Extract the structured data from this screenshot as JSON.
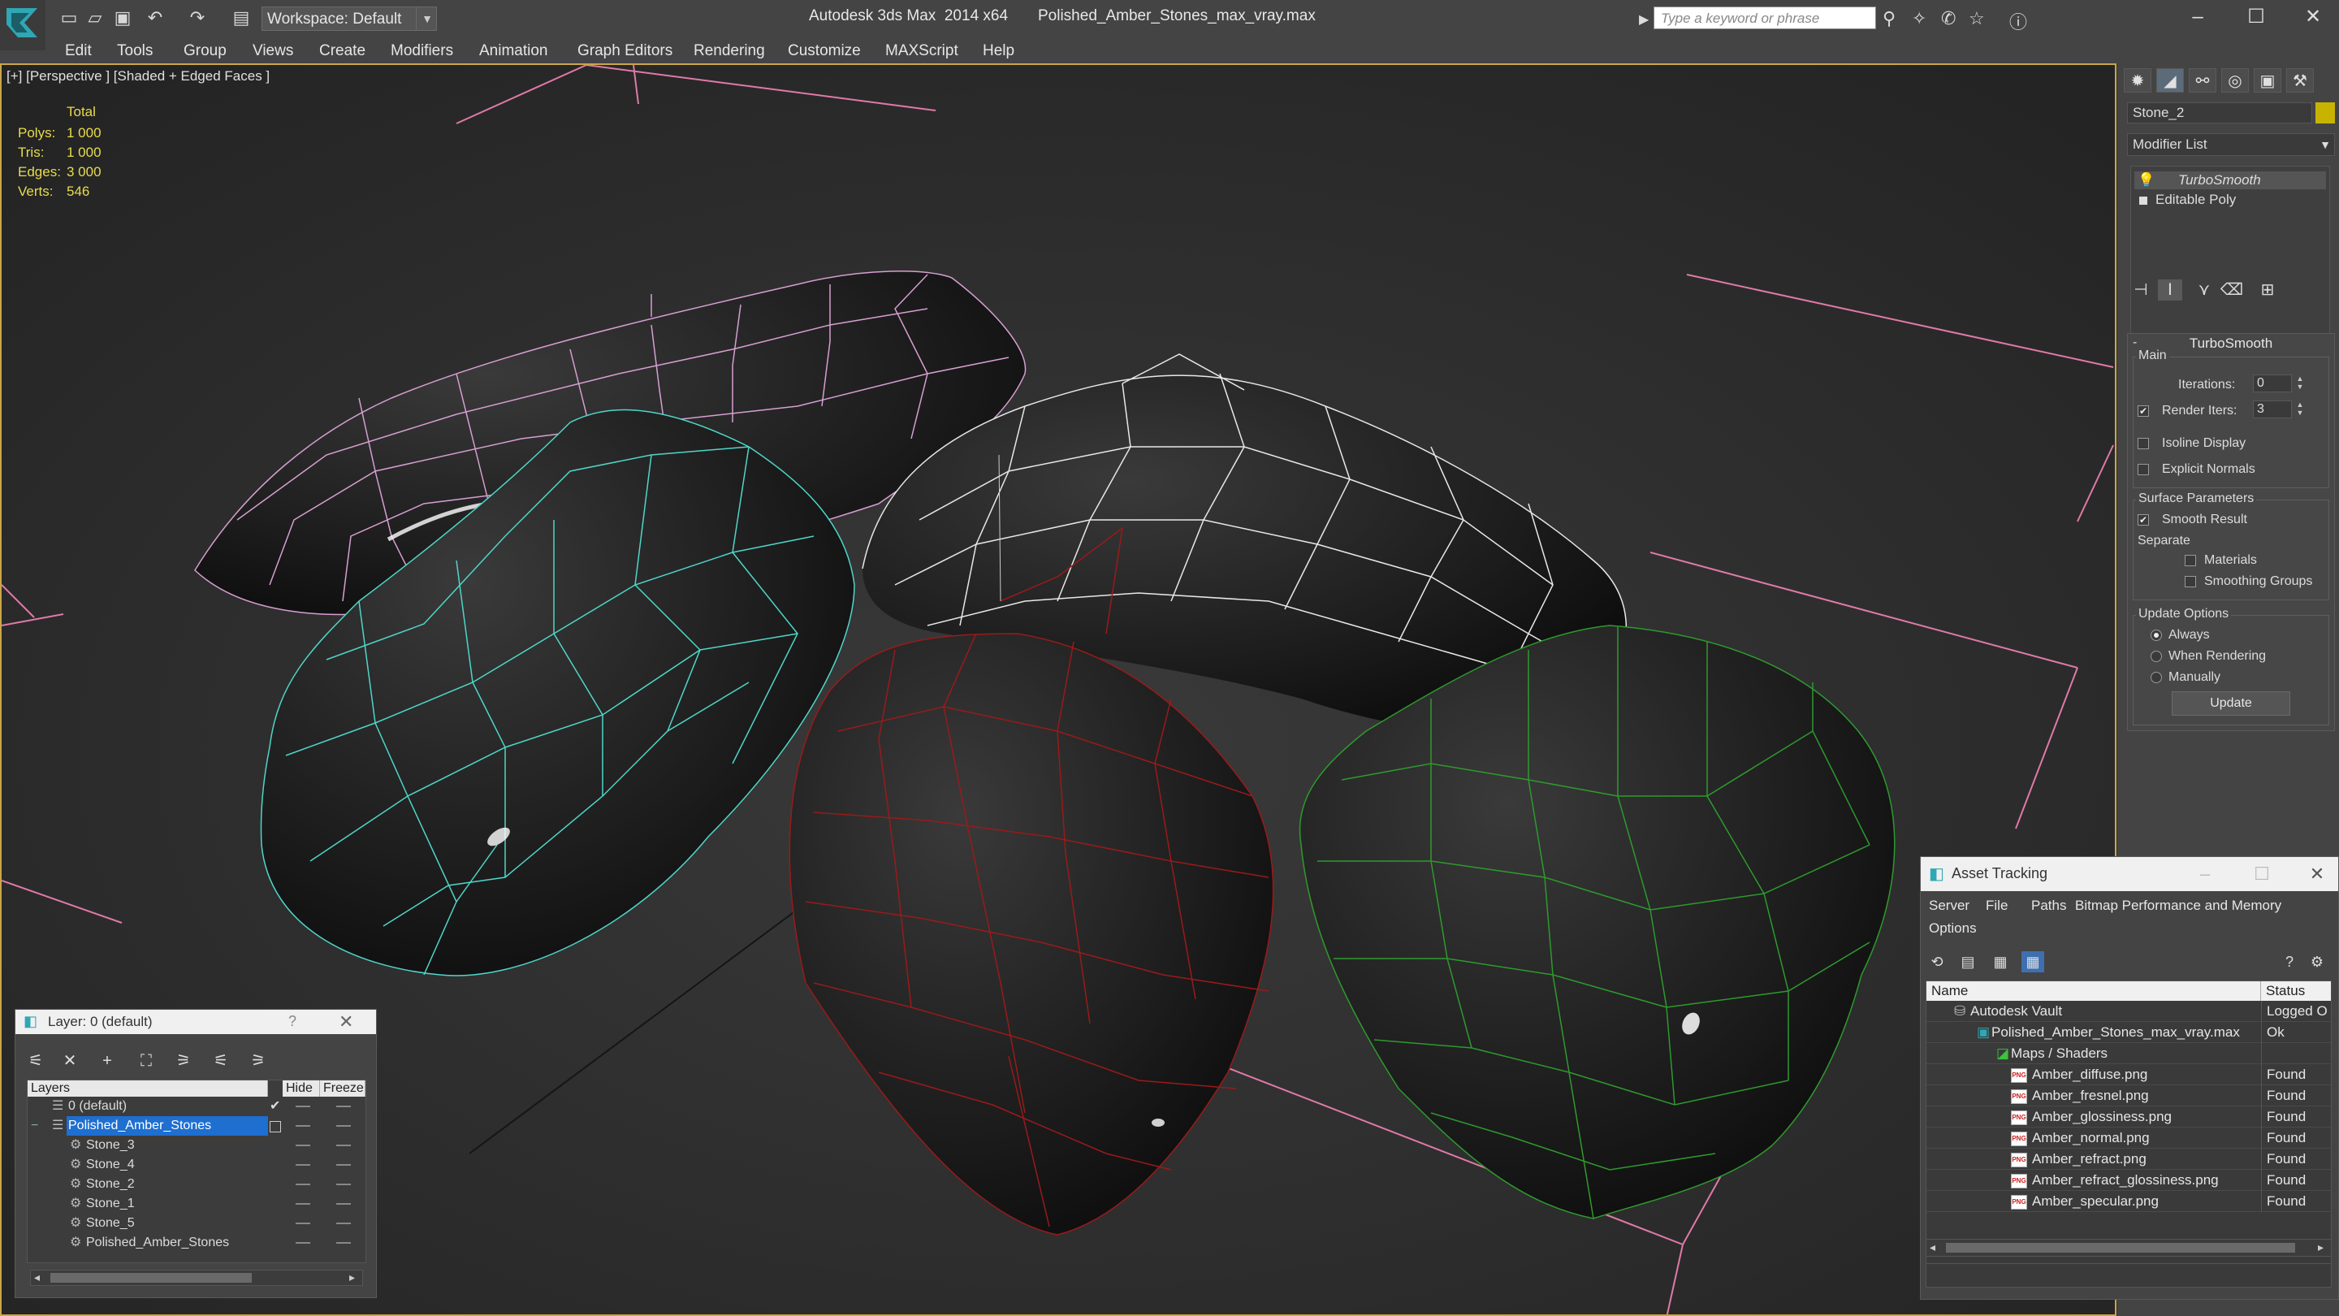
{
  "titlebar": {
    "workspace": "Workspace: Default",
    "app": "Autodesk 3ds Max  2014 x64",
    "file": "Polished_Amber_Stones_max_vray.max",
    "search_placeholder": "Type a keyword or phrase"
  },
  "menu": [
    "Edit",
    "Tools",
    "Group",
    "Views",
    "Create",
    "Modifiers",
    "Animation",
    "Graph Editors",
    "Rendering",
    "Customize",
    "MAXScript",
    "Help"
  ],
  "viewport": {
    "label": "[+] [Perspective ] [Shaded + Edged Faces ]",
    "stats_header": "Total",
    "stats": [
      {
        "label": "Polys:",
        "value": "1 000"
      },
      {
        "label": "Tris:",
        "value": "1 000"
      },
      {
        "label": "Edges:",
        "value": "3 000"
      },
      {
        "label": "Verts:",
        "value": "546"
      }
    ]
  },
  "command_panel": {
    "object_name": "Stone_2",
    "object_color": "#c8b400",
    "modifier_list": "Modifier List",
    "stack": [
      "TurboSmooth",
      "Editable Poly"
    ],
    "turbosmooth": {
      "title": "TurboSmooth",
      "main_label": "Main",
      "iterations_label": "Iterations:",
      "iterations_value": "0",
      "render_iters_label": "Render Iters:",
      "render_iters_value": "3",
      "render_iters_checked": true,
      "isoline_label": "Isoline Display",
      "explicit_label": "Explicit Normals",
      "surface_label": "Surface Parameters",
      "smooth_result_label": "Smooth Result",
      "separate_label": "Separate",
      "materials_label": "Materials",
      "smoothing_groups_label": "Smoothing Groups",
      "update_options_label": "Update Options",
      "always_label": "Always",
      "when_rendering_label": "When Rendering",
      "manually_label": "Manually",
      "update_button": "Update"
    }
  },
  "layer_dialog": {
    "title": "Layer: 0 (default)",
    "help": "?",
    "columns": {
      "layers": "Layers",
      "hide": "Hide",
      "freeze": "Freeze"
    },
    "rows": [
      {
        "name": "0 (default)",
        "selected": false
      },
      {
        "name": "Polished_Amber_Stones",
        "selected": true
      },
      {
        "name": "Stone_3",
        "selected": false
      },
      {
        "name": "Stone_4",
        "selected": false
      },
      {
        "name": "Stone_2",
        "selected": false
      },
      {
        "name": "Stone_1",
        "selected": false
      },
      {
        "name": "Stone_5",
        "selected": false
      },
      {
        "name": "Polished_Amber_Stones",
        "selected": false
      }
    ]
  },
  "asset_tracking": {
    "title": "Asset Tracking",
    "menu": [
      "Server",
      "File",
      "Paths",
      "Bitmap Performance and Memory",
      "Options"
    ],
    "columns": {
      "name": "Name",
      "status": "Status"
    },
    "rows": [
      {
        "name": "Autodesk Vault",
        "status": "Logged O"
      },
      {
        "name": "Polished_Amber_Stones_max_vray.max",
        "status": "Ok"
      },
      {
        "name": "Maps / Shaders",
        "status": ""
      },
      {
        "name": "Amber_diffuse.png",
        "status": "Found"
      },
      {
        "name": "Amber_fresnel.png",
        "status": "Found"
      },
      {
        "name": "Amber_glossiness.png",
        "status": "Found"
      },
      {
        "name": "Amber_normal.png",
        "status": "Found"
      },
      {
        "name": "Amber_refract.png",
        "status": "Found"
      },
      {
        "name": "Amber_refract_glossiness.png",
        "status": "Found"
      },
      {
        "name": "Amber_specular.png",
        "status": "Found"
      }
    ]
  },
  "colors": {
    "viewport_bg": "#2a2a2a",
    "viewport_border": "#c9a64a",
    "stats_text": "#e7dc4c",
    "wire_pink": "#d79fd1",
    "wire_white": "#e8e8e8",
    "wire_cyan": "#4fd6c8",
    "wire_red": "#9a1a1a",
    "wire_green": "#2e9a2e",
    "grid_line": "#e07aa8"
  }
}
